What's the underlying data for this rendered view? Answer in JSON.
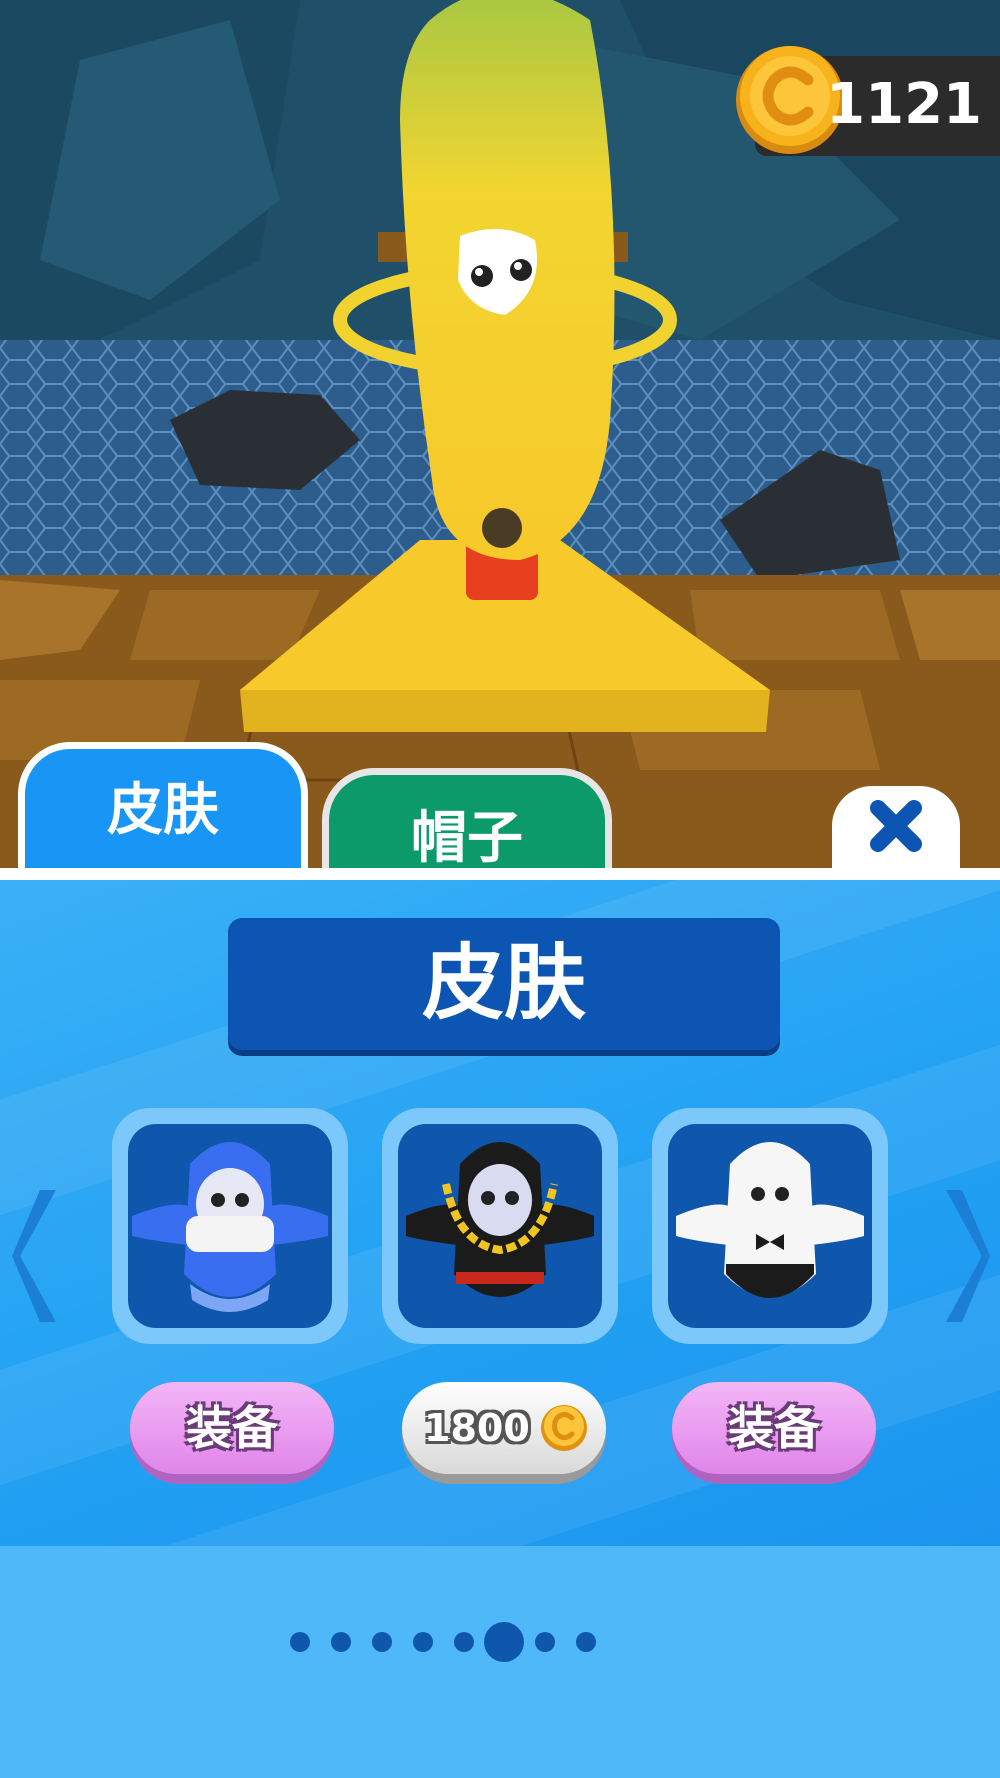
{
  "hud": {
    "coins": "1121",
    "coin_icon": "coin-icon"
  },
  "tabs": [
    {
      "label": "皮肤",
      "active": true
    },
    {
      "label": "帽子",
      "active": false
    }
  ],
  "close_icon": "close-icon",
  "panel": {
    "title": "皮肤",
    "items": [
      {
        "name": "blue-masked-skin",
        "action": "装备",
        "type": "equip"
      },
      {
        "name": "black-chain-skin",
        "price": "1800",
        "type": "buy"
      },
      {
        "name": "white-bowtie-skin",
        "action": "装备",
        "type": "equip"
      }
    ],
    "pagination": {
      "count": 8,
      "active_index": 5
    }
  },
  "colors": {
    "tab_skins": "#1996f5",
    "tab_hats": "#0d9a6b",
    "title_bg": "#0d55b2",
    "equip_button": "#e085ea",
    "coin": "#f7b21c"
  }
}
